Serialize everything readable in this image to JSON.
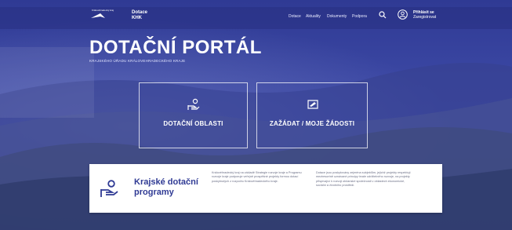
{
  "brand": {
    "region_label": "Královéhradecký kraj",
    "name_line1": "Dotace",
    "name_line2": "KHK"
  },
  "nav": {
    "items": [
      "Dotace",
      "Aktuality",
      "Dokumenty",
      "Podpora"
    ],
    "login_line1": "Přihlásit se",
    "login_line2": "Zaregistrovat"
  },
  "hero": {
    "title": "DOTAČNÍ PORTÁL",
    "subtitle": "KRAJSKÉHO ÚŘADU KRÁLOVEHRADECKÉHO KRAJE"
  },
  "tiles": [
    {
      "label": "DOTAČNÍ OBLASTI",
      "icon": "hand-coin-icon"
    },
    {
      "label": "ZAŽÁDAT / MOJE ŽÁDOSTI",
      "icon": "document-pen-icon"
    }
  ],
  "card": {
    "title_line1": "Krajské dotační",
    "title_line2": "programy",
    "text1": "Královéhradecký kraj na základě Strategie rozvoje kraje a Programu rozvoje kraje podporuje veřejně prospěšné projekty formou dotací poskytnutých z rozpočtu Královéhradeckého kraje.",
    "text2": "Dotace jsou poskytovány zejména subjektům, jejichž projekty respektují meziresortně uznávané principy trvale udržitelného rozvoje, na projekty přispívající k rozvoji občanské společnosti v oblastech ekonomické, sociální a životního prostředí."
  },
  "colors": {
    "primary": "#2f3a94",
    "hero_overlay": "#3e4aa6",
    "card_bg": "#ffffff",
    "text_muted": "#6b6f86"
  }
}
